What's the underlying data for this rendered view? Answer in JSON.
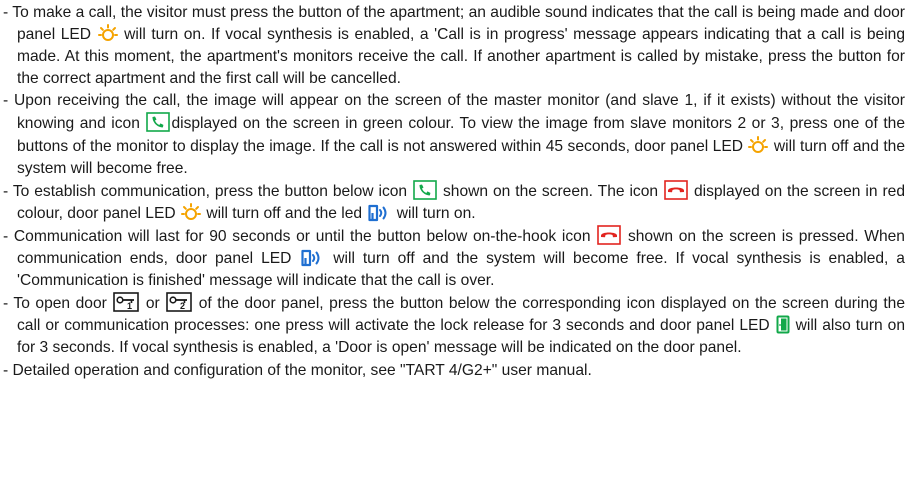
{
  "paragraphs": [
    {
      "segments": [
        "- To make a call, the visitor must press the button of the apartment; an audible sound indicates that the call is being made and door panel LED ",
        " will turn on. If vocal synthesis is enabled, a 'Call is in progress' message appears indicating that a call is being made. At this moment, the apartment's monitors receive the call. If another apartment is called by mistake, press the button for the correct apartment and the first call will be cancelled."
      ],
      "icons": [
        "sun-led-icon"
      ]
    },
    {
      "segments": [
        "- Upon receiving the call, the image will appear on the screen of the master monitor (and slave 1, if it exists) without the visitor knowing and icon ",
        "displayed on the screen in green colour. To view the image from slave monitors 2 or 3, press one of the buttons of the monitor to display the image. If the call is not answered within 45 seconds, door panel LED ",
        " will turn off and the system will become free."
      ],
      "icons": [
        "phone-green-icon",
        "sun-led-icon"
      ]
    },
    {
      "segments": [
        "- To establish communication, press the button below icon ",
        " shown on the screen. The icon ",
        " displayed on the screen in red colour, door panel LED ",
        " will turn off and the led ",
        " will turn on."
      ],
      "icons": [
        "phone-green-icon",
        "hangup-red-icon",
        "sun-led-icon",
        "speaker-led-icon"
      ]
    },
    {
      "segments": [
        "- Communication will last for 90 seconds or until the button below on-the-hook icon ",
        " shown on the screen is pressed. When communication ends, door panel LED ",
        " will turn off and the system will become free. If vocal synthesis is enabled, a 'Communication is finished' message will indicate that the call is over."
      ],
      "icons": [
        "hangup-red-icon",
        "speaker-led-icon"
      ]
    },
    {
      "segments": [
        "- To open door ",
        " or ",
        " of the door panel, press the button below the corresponding icon displayed on the screen during the call or communication processes: one press will activate the lock release for 3 seconds and door panel LED ",
        " will also turn on for 3 seconds. If vocal synthesis is enabled, a 'Door is open' message will be indicated on the door panel."
      ],
      "icons": [
        "door-key-1-icon",
        "door-key-2-icon",
        "door-led-icon"
      ]
    },
    {
      "segments": [
        "- Detailed operation and configuration of the monitor, see \"TART 4/G2+\" user manual."
      ],
      "icons": []
    }
  ],
  "icon_labels": {
    "door-key-1-icon": "1",
    "door-key-2-icon": "2"
  },
  "colors": {
    "text": "#1a1a1a",
    "led_orange": "#f5a300",
    "green": "#12a84a",
    "red": "#e2241f",
    "blue": "#1f6fd1"
  }
}
